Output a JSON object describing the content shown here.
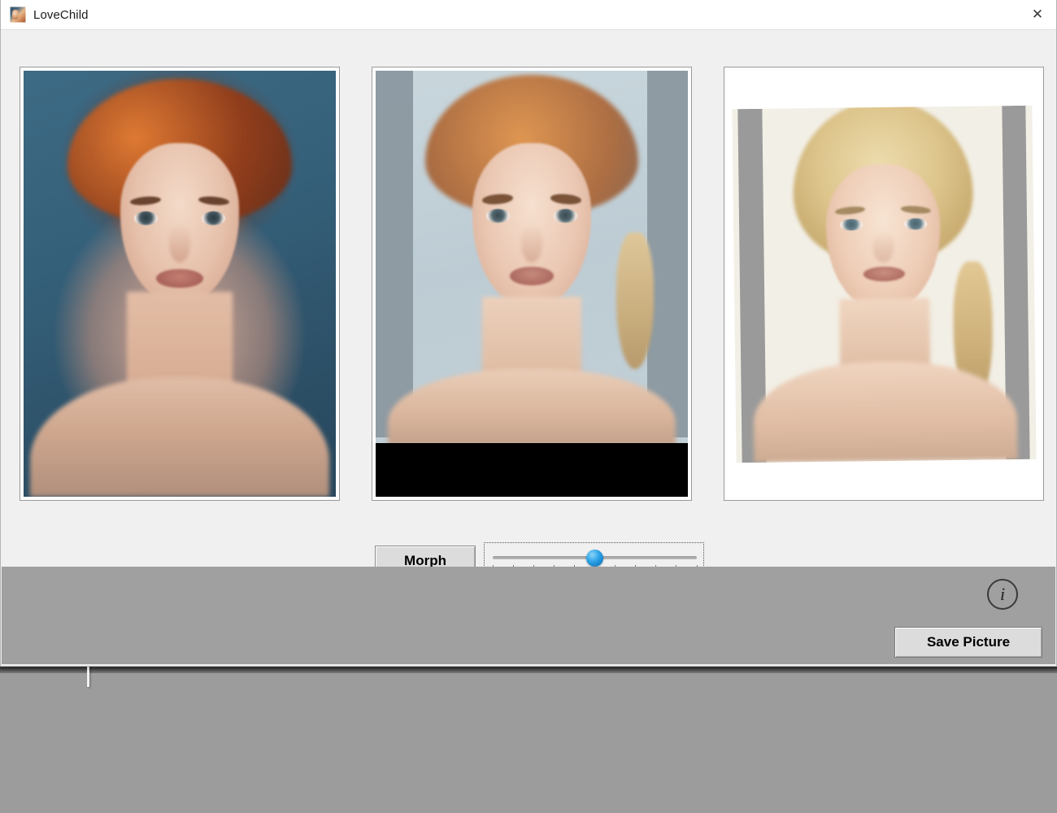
{
  "window": {
    "title": "LoveChild",
    "icon": "app-photo-icon",
    "close_label": "✕"
  },
  "panels": [
    {
      "name": "source-image-left",
      "alt": "Portrait of woman with curly red hair on teal background"
    },
    {
      "name": "morphed-image-center",
      "alt": "Morphed blend of the two portraits"
    },
    {
      "name": "source-image-right",
      "alt": "Portrait of blonde woman on light background"
    }
  ],
  "controls": {
    "morph_button": "Morph",
    "slider": {
      "name": "morph-ratio-slider",
      "min": 0,
      "max": 10,
      "value": 5,
      "ticks": [
        "0",
        "1",
        "2",
        "3",
        "4",
        "5",
        "6",
        "7",
        "8",
        "9",
        "10"
      ]
    }
  },
  "footer": {
    "info_icon": "i",
    "info_icon_name": "info-icon",
    "save_button": "Save Picture"
  },
  "colors": {
    "window_bg": "#f0f0f0",
    "footer_bg": "#a0a0a0",
    "button_bg": "#dcdcdc",
    "slider_thumb": "#1380c9",
    "desktop_bg": "#9e9e9e"
  }
}
